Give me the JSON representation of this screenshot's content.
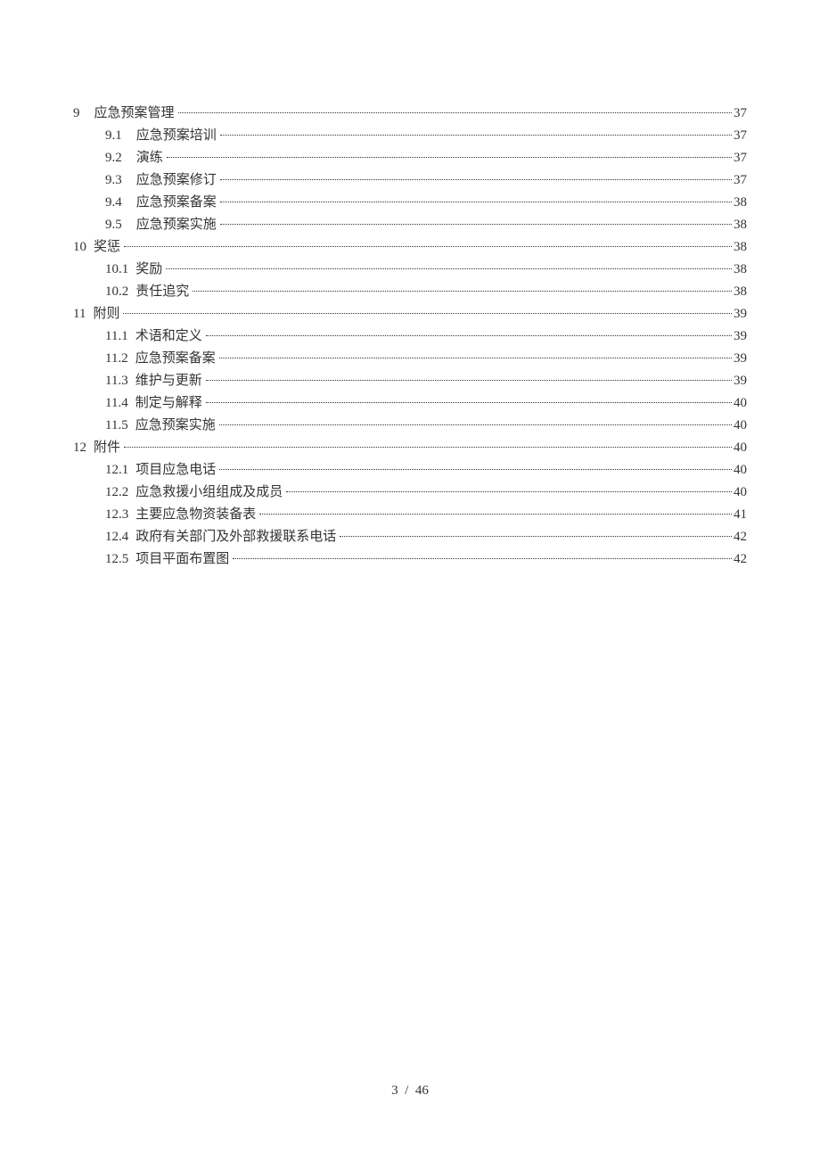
{
  "toc": [
    {
      "level": 1,
      "num": "9",
      "gap": "md",
      "title": "应急预案管理",
      "page": "37"
    },
    {
      "level": 2,
      "num": "9.1",
      "gap": "md",
      "title": "应急预案培训",
      "page": "37"
    },
    {
      "level": 2,
      "num": "9.2",
      "gap": "md",
      "title": "演练",
      "page": "37"
    },
    {
      "level": 2,
      "num": "9.3",
      "gap": "md",
      "title": "应急预案修订",
      "page": "37"
    },
    {
      "level": 2,
      "num": "9.4",
      "gap": "md",
      "title": "应急预案备案",
      "page": "38"
    },
    {
      "level": 2,
      "num": "9.5",
      "gap": "md",
      "title": "应急预案实施",
      "page": "38"
    },
    {
      "level": 1,
      "num": "10",
      "gap": "sm",
      "title": "奖惩",
      "page": "38"
    },
    {
      "level": 2,
      "num": "10.1",
      "gap": "sm",
      "title": "奖励",
      "page": "38"
    },
    {
      "level": 2,
      "num": "10.2",
      "gap": "sm",
      "title": "责任追究",
      "page": "38"
    },
    {
      "level": 1,
      "num": "11",
      "gap": "sm",
      "title": "附则",
      "page": "39"
    },
    {
      "level": 2,
      "num": "11.1",
      "gap": "sm",
      "title": "术语和定义",
      "page": "39"
    },
    {
      "level": 2,
      "num": "11.2",
      "gap": "sm",
      "title": "应急预案备案",
      "page": "39"
    },
    {
      "level": 2,
      "num": "11.3",
      "gap": "sm",
      "title": "维护与更新",
      "page": "39"
    },
    {
      "level": 2,
      "num": "11.4",
      "gap": "sm",
      "title": "制定与解释",
      "page": "40"
    },
    {
      "level": 2,
      "num": "11.5",
      "gap": "sm",
      "title": "应急预案实施",
      "page": "40"
    },
    {
      "level": 1,
      "num": "12",
      "gap": "sm",
      "title": "附件",
      "page": "40"
    },
    {
      "level": 2,
      "num": "12.1",
      "gap": "sm",
      "title": "项目应急电话",
      "page": "40"
    },
    {
      "level": 2,
      "num": "12.2",
      "gap": "sm",
      "title": "应急救援小组组成及成员",
      "page": "40"
    },
    {
      "level": 2,
      "num": "12.3",
      "gap": "sm",
      "title": "主要应急物资装备表",
      "page": "41"
    },
    {
      "level": 2,
      "num": "12.4",
      "gap": "sm",
      "title": "政府有关部门及外部救援联系电话",
      "page": "42"
    },
    {
      "level": 2,
      "num": "12.5",
      "gap": "sm",
      "title": "项目平面布置图",
      "page": "42"
    }
  ],
  "footer": {
    "current": "3",
    "sep": "/",
    "total": "46"
  }
}
